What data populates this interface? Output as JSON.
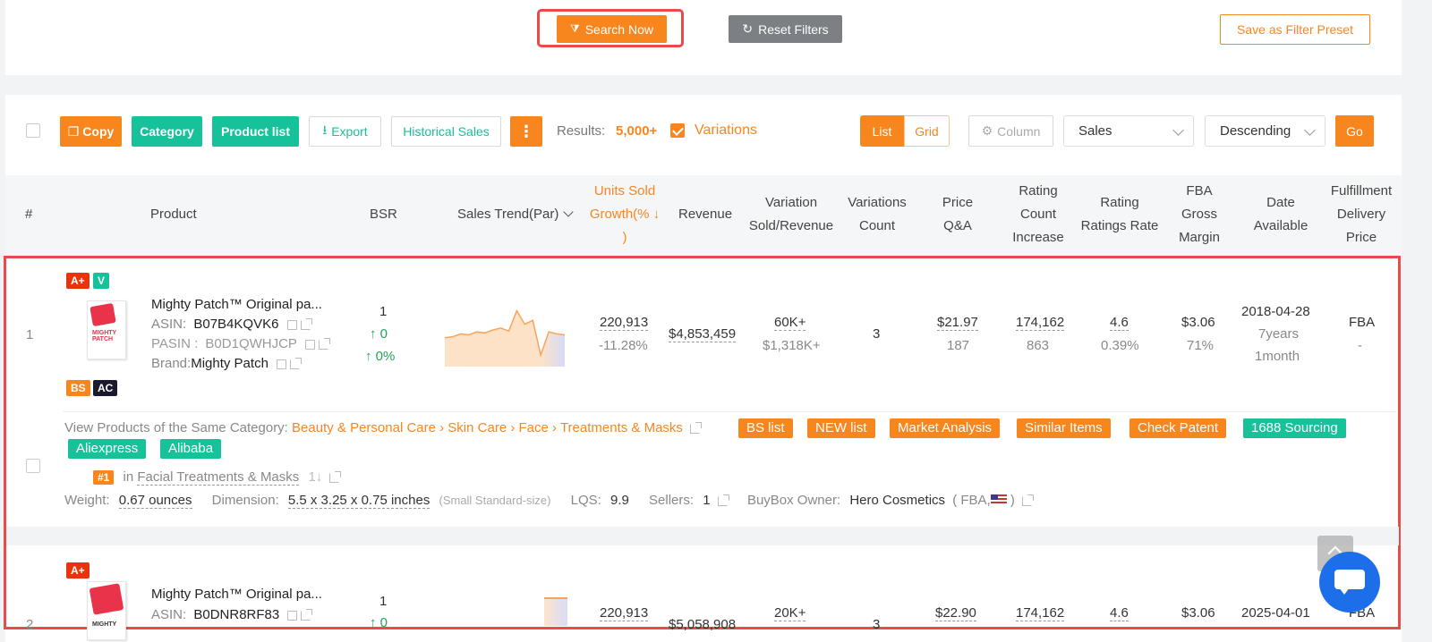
{
  "top": {
    "search_now": "Search Now",
    "reset_filters": "Reset Filters",
    "save_preset": "Save as Filter Preset"
  },
  "toolbar": {
    "copy": "Copy",
    "category": "Category",
    "product_list": "Product list",
    "export": "Export",
    "historical_sales": "Historical Sales",
    "more": "⋮",
    "results_label": "Results:",
    "results_value": "5,000+",
    "variations": "Variations",
    "list": "List",
    "grid": "Grid",
    "column": "Column",
    "sort_by": "Sales",
    "order": "Descending",
    "go": "Go"
  },
  "columns": {
    "num": "#",
    "product": "Product",
    "bsr": "BSR",
    "sales_trend": "Sales Trend(Par)",
    "units_sold_1": "Units Sold",
    "units_sold_2": "Growth(% ↓",
    "units_sold_3": ")",
    "revenue": "Revenue",
    "variation_1": "Variation",
    "variation_2": "Sold/Revenue",
    "variations_count_1": "Variations",
    "variations_count_2": "Count",
    "price_1": "Price",
    "price_2": "Q&A",
    "rating_count_1": "Rating",
    "rating_count_2": "Count",
    "rating_count_3": "Increase",
    "rating_rate_1": "Rating",
    "rating_rate_2": "Ratings Rate",
    "fba_1": "FBA",
    "fba_2": "Gross",
    "fba_3": "Margin",
    "date_1": "Date",
    "date_2": "Available",
    "fulfill_1": "Fulfillment",
    "fulfill_2": "Delivery",
    "fulfill_3": "Price"
  },
  "row1": {
    "index": "1",
    "badges": [
      "A+",
      "V",
      "BS",
      "AC"
    ],
    "title": "Mighty Patch™ Original pa...",
    "asin_label": "ASIN:",
    "asin": "B07B4KQVK6",
    "pasin_label": "PASIN :",
    "pasin": "B0D1QWHJCP",
    "brand_label": "Brand:",
    "brand": "Mighty Patch",
    "bsr": "1",
    "bsr_change": "↑ 0",
    "bsr_pct": "↑ 0%",
    "units": "220,913",
    "growth": "-11.28%",
    "revenue": "$4,853,459",
    "var_sold": "60K+",
    "var_rev": "$1,318K+",
    "var_count": "3",
    "price": "$21.97",
    "qa": "187",
    "rating_count": "174,162",
    "rating_inc": "863",
    "rating": "4.6",
    "rating_rate": "0.39%",
    "fba": "$3.06",
    "margin": "71%",
    "date": "2018-04-28",
    "age_1": "7years",
    "age_2": "1month",
    "fulfill": "FBA",
    "delivery": "-",
    "category_label": "View Products of the Same Category:",
    "cat_1": "Beauty & Personal Care",
    "cat_2": "Skin Care",
    "cat_3": "Face",
    "cat_4": "Treatments & Masks",
    "tags": [
      "BS list",
      "NEW list",
      "Market Analysis",
      "Similar Items",
      "Check Patent",
      "1688 Sourcing",
      "Aliexpress",
      "Alibaba"
    ],
    "rank_badge": "#1",
    "rank_in": "in",
    "rank_cat": "Facial Treatments & Masks",
    "rank_arrows": "1↓",
    "weight_label": "Weight:",
    "weight": "0.67 ounces",
    "dimension_label": "Dimension:",
    "dimension": "5.5 x 3.25 x 0.75 inches",
    "size_tier": "(Small Standard-size)",
    "lqs_label": "LQS:",
    "lqs": "9.9",
    "sellers_label": "Sellers:",
    "sellers": "1",
    "buybox_label": "BuyBox Owner:",
    "buybox": "Hero Cosmetics",
    "buybox_meta_open": "( FBA,",
    "buybox_meta_close": ")",
    "img_text": "MIGHTY PATCH"
  },
  "row2": {
    "index": "2",
    "badges": [
      "A+"
    ],
    "title": "Mighty Patch™ Original pa...",
    "asin_label": "ASIN:",
    "asin": "B0DNR8RF83",
    "bsr": "1",
    "bsr_change": "↑ 0",
    "units": "220,913",
    "revenue": "$5,058,908",
    "var_sold": "20K+",
    "var_count": "3",
    "price": "$22.90",
    "rating_count": "174,162",
    "rating": "4.6",
    "fba": "$3.06",
    "date": "2025-04-01",
    "fulfill": "FBA",
    "img_text": "MIGHTY"
  },
  "chart_data": {
    "type": "area",
    "x": [
      0,
      1,
      2,
      3,
      4,
      5,
      6,
      7,
      8,
      9,
      10,
      11,
      12,
      13,
      14,
      15
    ],
    "series": [
      {
        "values": [
          30,
          31,
          34,
          33,
          36,
          35,
          38,
          40,
          37,
          58,
          44,
          48,
          12,
          36,
          34,
          33
        ]
      }
    ],
    "ylim": [
      0,
      65
    ]
  },
  "colors": {
    "accent": "#f7861e",
    "green": "#17c19a",
    "highlight": "#e94b4b",
    "chat": "#1c6fe8"
  }
}
